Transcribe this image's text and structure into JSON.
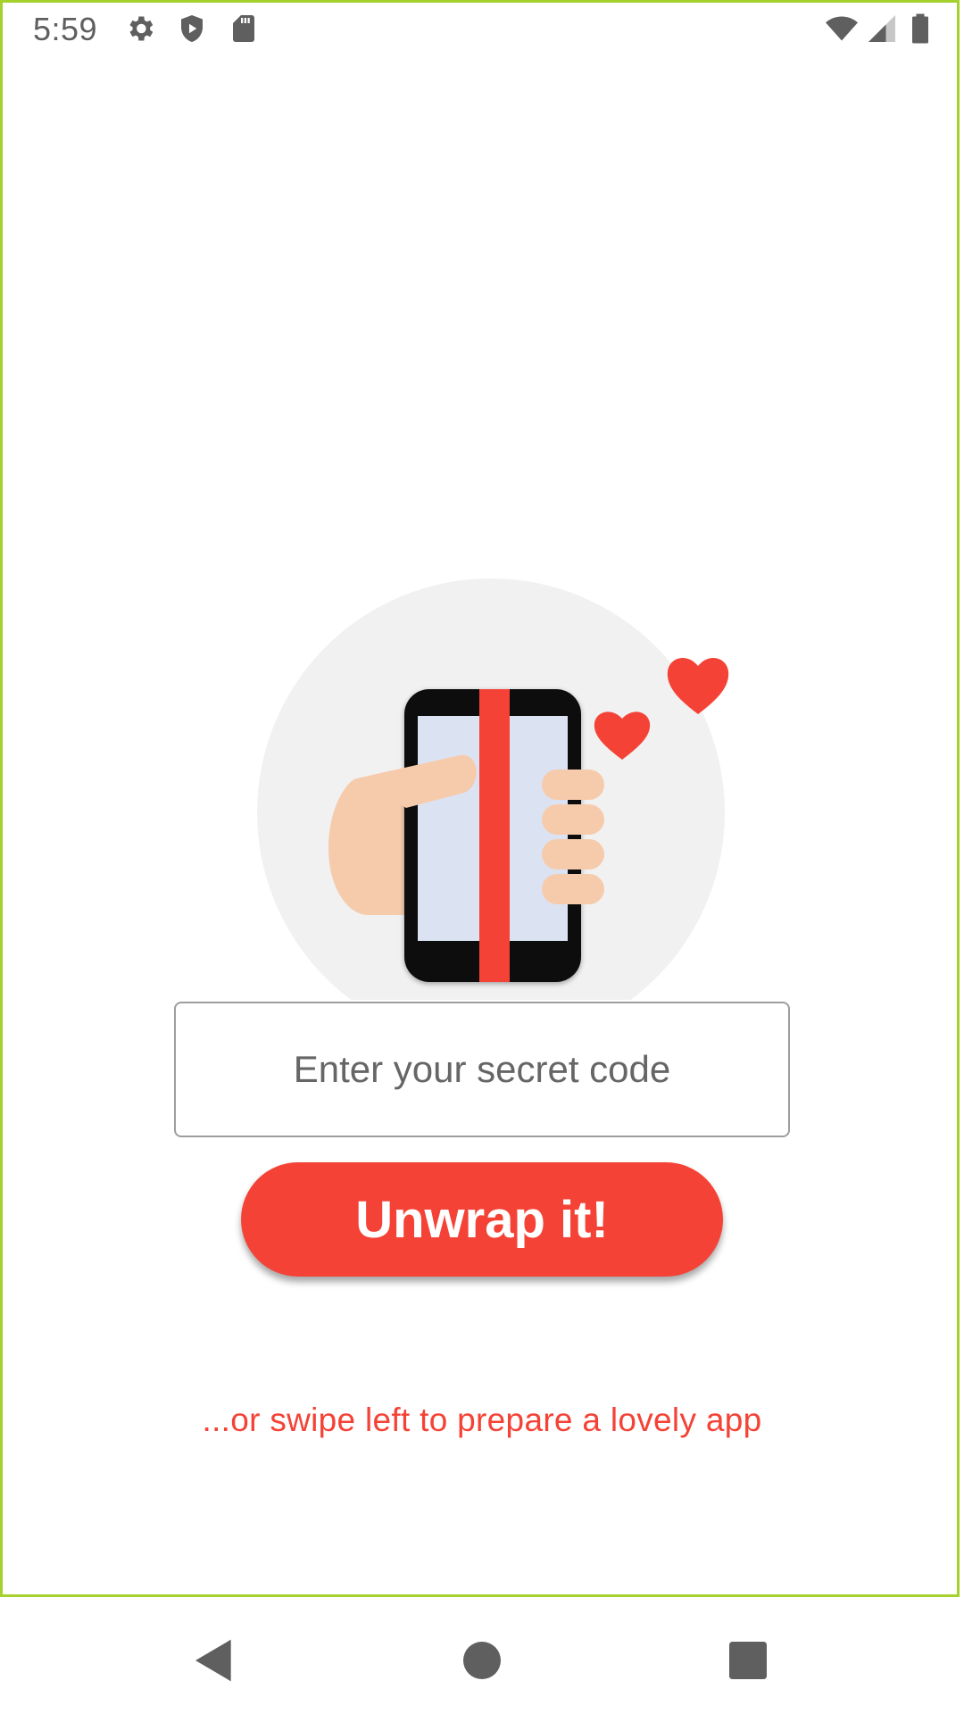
{
  "status_bar": {
    "time": "5:59",
    "left_icons": [
      "settings-icon",
      "shield-play-icon",
      "sd-card-icon"
    ],
    "right_icons": [
      "wifi-icon",
      "cell-signal-icon",
      "battery-icon"
    ]
  },
  "illustration": {
    "subject": "hand-holding-wrapped-phone",
    "colors": {
      "circle_bg": "#f1f1f1",
      "phone_body": "#111111",
      "phone_screen": "#dbe3f3",
      "ribbon": "#f44336",
      "skin": "#f6cbac",
      "heart": "#f44336"
    }
  },
  "code_input": {
    "placeholder": "Enter your secret code",
    "value": ""
  },
  "primary_button": {
    "label": "Unwrap it!",
    "color": "#f44336"
  },
  "swipe_hint": {
    "text": "...or swipe left to prepare a lovely app",
    "color": "#f44336"
  },
  "nav_bar": {
    "buttons": [
      "back-icon",
      "home-icon",
      "recents-icon"
    ]
  },
  "frame_accent": "#a4d12c"
}
